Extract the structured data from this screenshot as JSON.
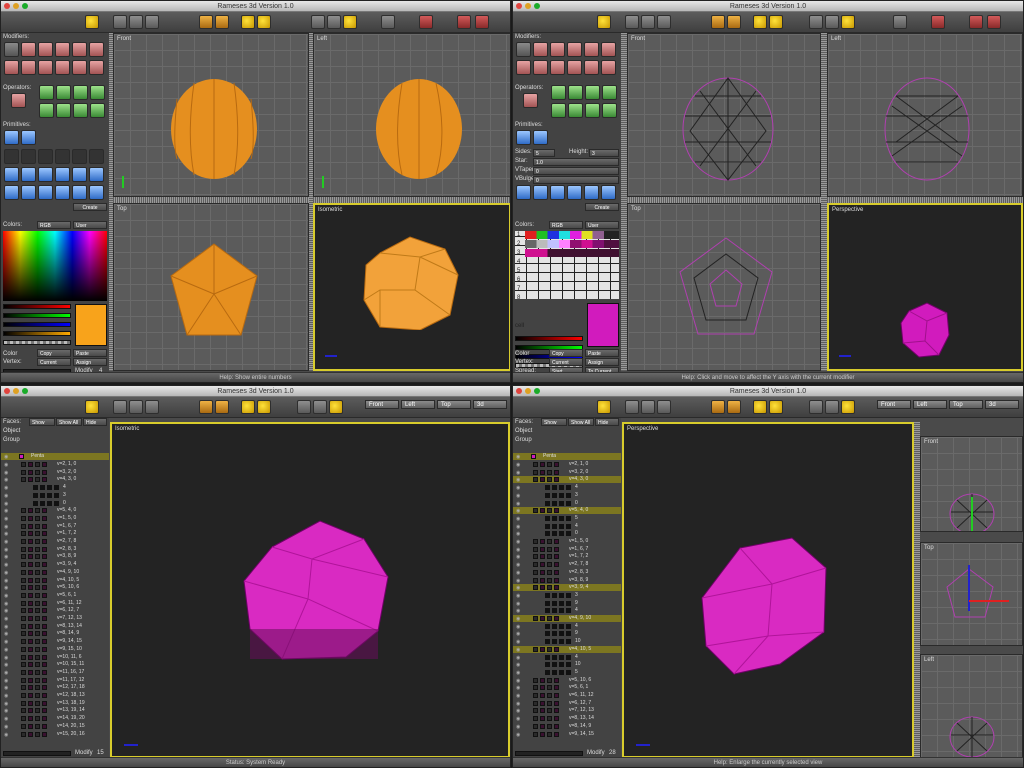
{
  "app": {
    "title": "Rameses 3d Version 1.0"
  },
  "colors": {
    "accent": "#d8cc2c",
    "orange": "#e58f1f",
    "magenta": "#d11bbd"
  },
  "w1": {
    "left": {
      "modifiers": "Modifiers:",
      "operators": "Operators:",
      "primitives": "Primitives:",
      "colors": "Colors:",
      "rgb": "RGB",
      "user": "User",
      "create": "Create",
      "color_label": "Color",
      "vertex_label": "Vertex:",
      "copy": "Copy",
      "current": "Current",
      "paste": "Paste",
      "assign": "Assign",
      "modify": "Modify",
      "modify_val": "4"
    },
    "views": {
      "front": "Front",
      "left": "Left",
      "top": "Top",
      "iso": "Isometric"
    },
    "status": "Help: Show entire numbers"
  },
  "w2": {
    "left": {
      "modifiers": "Modifiers:",
      "operators": "Operators:",
      "primitives": "Primitives:",
      "sides": "Sides:",
      "sides_val": "5",
      "height": "Height:",
      "height_val": "3",
      "star": "Star:",
      "star_val": "1.0",
      "vtaper": "VTaper:",
      "vtaper_val": "0",
      "vbulge": "VBulge:",
      "vbulge_val": "0",
      "create": "Create",
      "colors": "Colors:",
      "rgb": "RGB",
      "user": "User",
      "color_label": "Color",
      "vertex_label": "Vertex:",
      "spread_label": "Spread:",
      "copy": "Copy",
      "current": "Current",
      "start": "Start",
      "paste": "Paste",
      "assign": "Assign",
      "to_current": "To Current",
      "cells": [
        "1",
        "2",
        "3",
        "4",
        "5",
        "6",
        "7",
        "8",
        "cell"
      ]
    },
    "views": {
      "front": "Front",
      "left": "Left",
      "top": "Top",
      "persp": "Perspective"
    },
    "status": "Help: Click and move to affect the Y axis with the current modifier"
  },
  "w3": {
    "left": {
      "faces": "Faces:",
      "show": "Show",
      "show_all": "Show All",
      "hide": "Hide",
      "object": "Object",
      "group": "Group",
      "root": "Penta",
      "modify": "Modify",
      "modify_val": "15",
      "rows": [
        "v=2, 1, 0",
        "v=3, 2, 0",
        "v=4, 3, 0",
        "4",
        "3",
        "0",
        "v=5, 4, 0",
        "v=1, 5, 0",
        "v=1, 6, 7",
        "v=1, 7, 2",
        "v=2, 7, 8",
        "v=2, 8, 3",
        "v=3, 8, 9",
        "v=3, 9, 4",
        "v=4, 9, 10",
        "v=4, 10, 5",
        "v=5, 10, 6",
        "v=5, 6, 1",
        "v=6, 11, 12",
        "v=6, 12, 7",
        "v=7, 12, 13",
        "v=8, 13, 14",
        "v=8, 14, 9",
        "v=9, 14, 15",
        "v=9, 15, 10",
        "v=10, 11, 6",
        "v=10, 15, 11",
        "v=11, 16, 17",
        "v=11, 17, 12",
        "v=12, 17, 18",
        "v=12, 18, 13",
        "v=13, 18, 19",
        "v=13, 19, 14",
        "v=14, 19, 20",
        "v=14, 20, 15",
        "v=15, 20, 16"
      ]
    },
    "tb": {
      "front": "Front",
      "left": "Left",
      "top": "Top",
      "three_d": "3d"
    },
    "views": {
      "iso": "Isometric"
    },
    "status": "Status: System Ready"
  },
  "w4": {
    "left": {
      "faces": "Faces:",
      "show": "Show",
      "show_all": "Show All",
      "hide": "Hide",
      "object": "Object",
      "group": "Group",
      "root": "Penta",
      "modify": "Modify",
      "modify_val": "28",
      "rows": [
        "v=2, 1, 0",
        "v=3, 2, 0",
        "v=4, 3, 0",
        "4",
        "3",
        "0",
        "v=5, 4, 0",
        "5",
        "4",
        "0",
        "v=1, 5, 0",
        "v=1, 6, 7",
        "v=1, 7, 2",
        "v=2, 7, 8",
        "v=2, 8, 3",
        "v=3, 8, 9",
        "v=3, 9, 4",
        "3",
        "9",
        "4",
        "v=4, 9, 10",
        "4",
        "9",
        "10",
        "v=4, 10, 5",
        "4",
        "10",
        "5",
        "v=5, 10, 6",
        "v=5, 6, 1",
        "v=6, 11, 12",
        "v=6, 12, 7",
        "v=7, 12, 13",
        "v=8, 13, 14",
        "v=8, 14, 9",
        "v=9, 14, 15"
      ]
    },
    "tb": {
      "front": "Front",
      "left": "Left",
      "top": "Top",
      "three_d": "3d"
    },
    "views": {
      "persp": "Perspective",
      "front": "Front",
      "top": "Top",
      "left": "Left"
    },
    "status": "Help: Enlarge the currently selected view"
  }
}
